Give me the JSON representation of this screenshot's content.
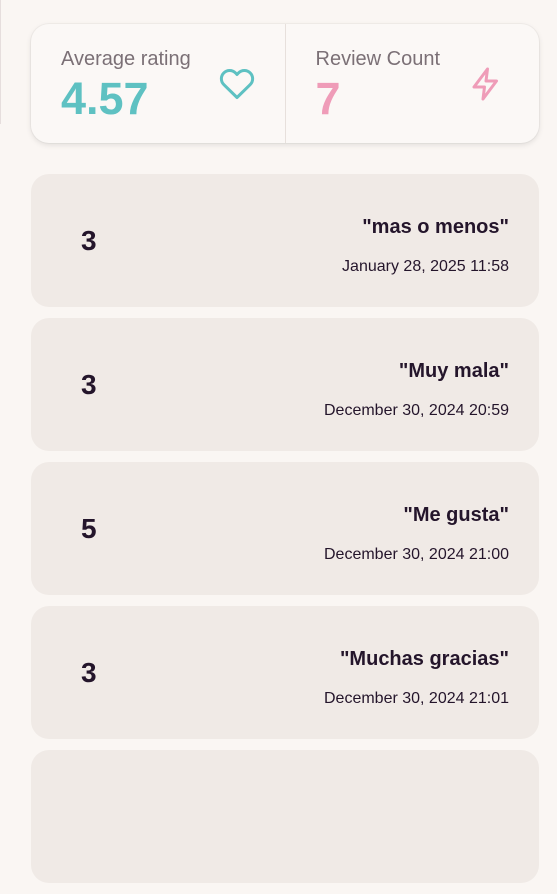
{
  "stats": {
    "average": {
      "label": "Average rating",
      "value": "4.57",
      "icon": "heart-icon",
      "color": "#5ec1c2"
    },
    "count": {
      "label": "Review Count",
      "value": "7",
      "icon": "lightning-icon",
      "color": "#ef9cb8"
    }
  },
  "reviews": [
    {
      "score": "3",
      "comment": "\"mas o menos\"",
      "date": "January 28, 2025 11:58"
    },
    {
      "score": "3",
      "comment": "\"Muy mala\"",
      "date": "December 30, 2024 20:59"
    },
    {
      "score": "5",
      "comment": "\"Me gusta\"",
      "date": "December 30, 2024 21:00"
    },
    {
      "score": "3",
      "comment": "\"Muchas gracias\"",
      "date": "December 30, 2024 21:01"
    }
  ]
}
